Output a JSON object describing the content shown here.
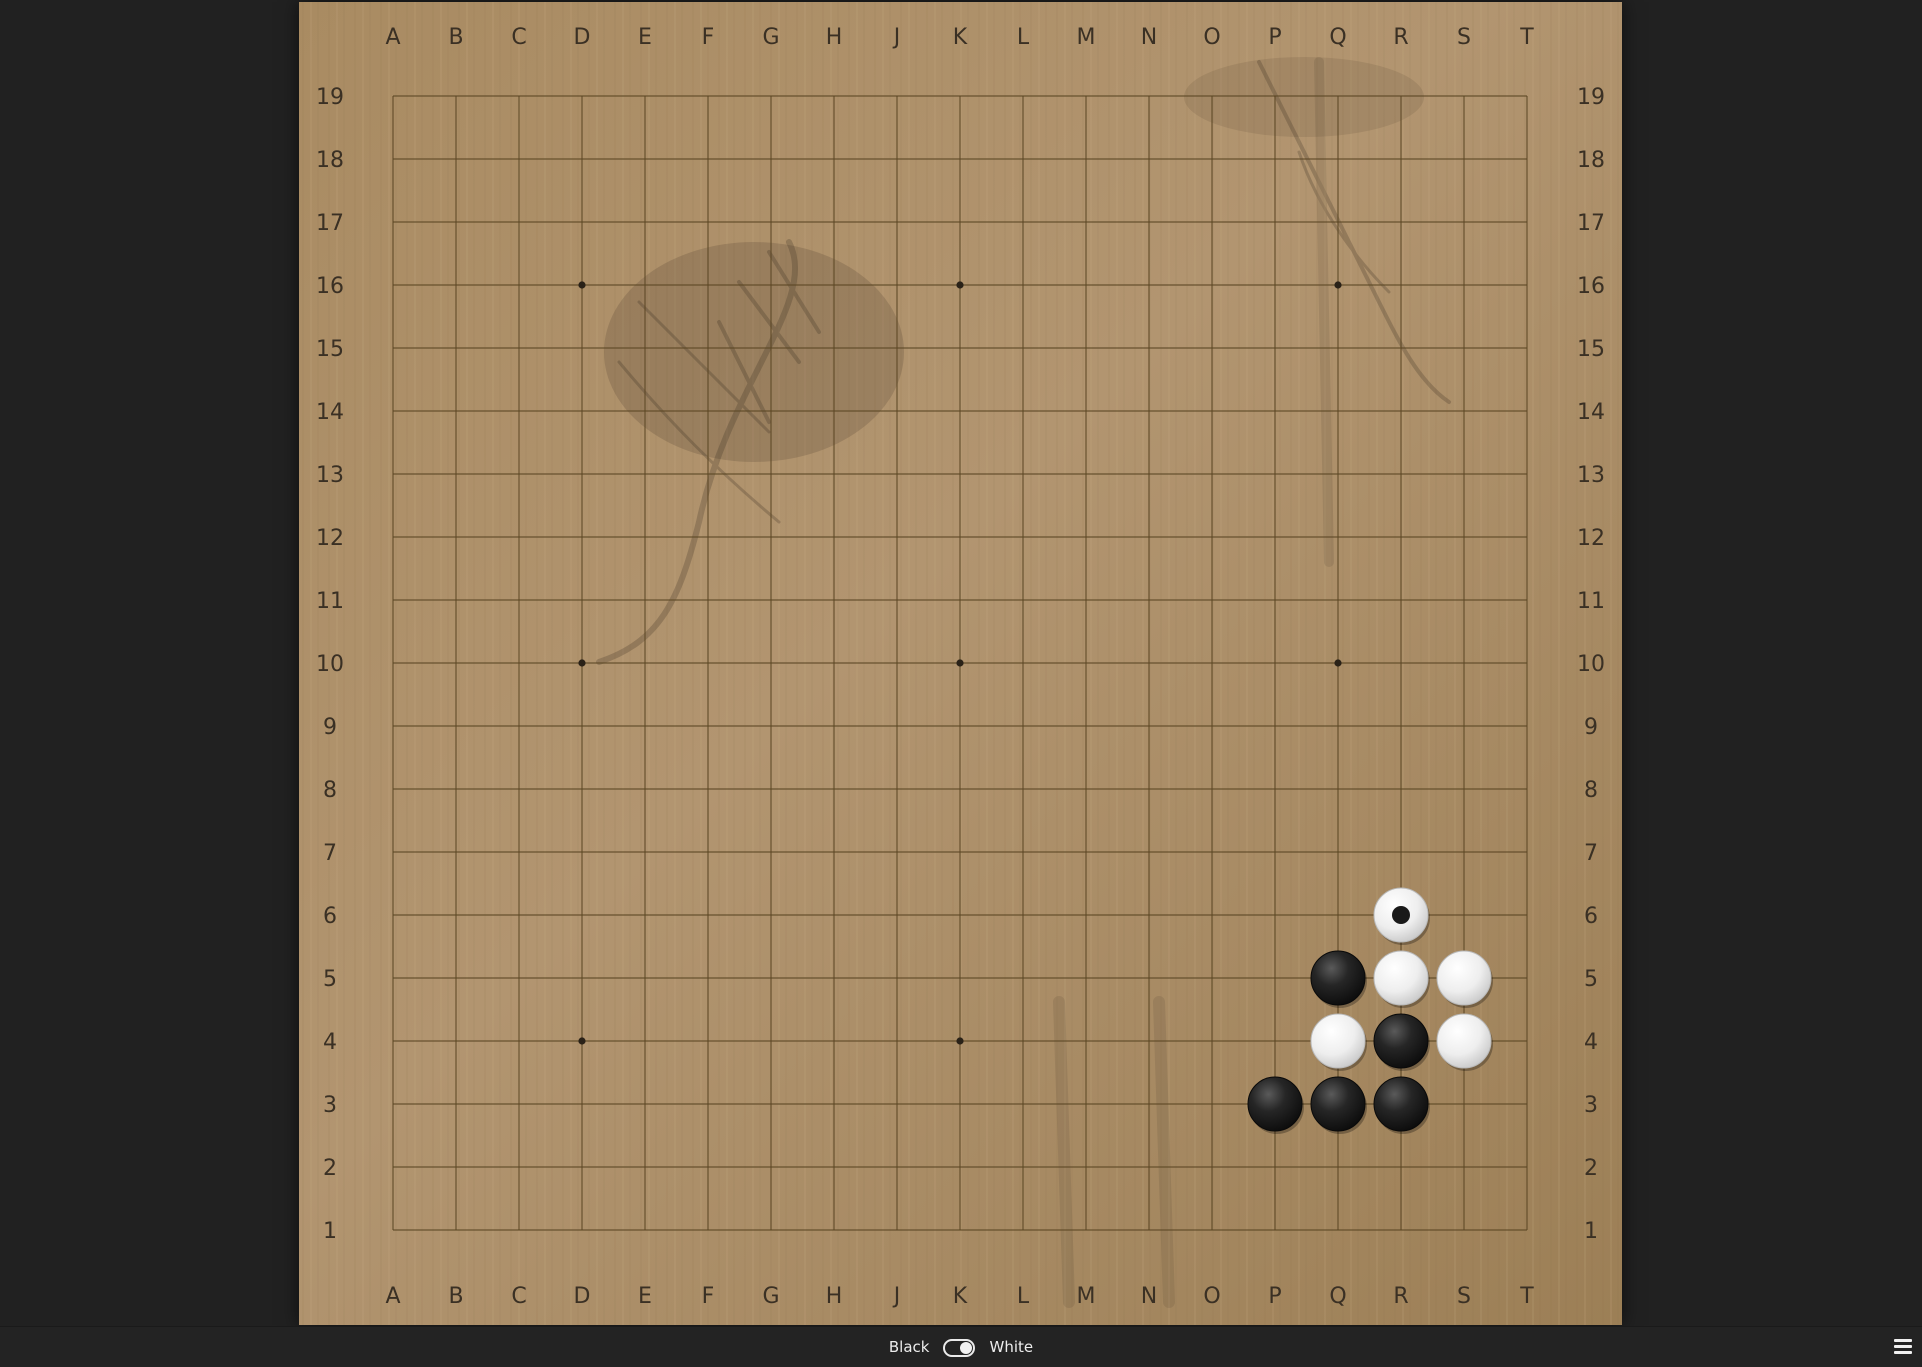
{
  "board": {
    "size": 19,
    "columns": [
      "A",
      "B",
      "C",
      "D",
      "E",
      "F",
      "G",
      "H",
      "J",
      "K",
      "L",
      "M",
      "N",
      "O",
      "P",
      "Q",
      "R",
      "S",
      "T"
    ],
    "rows": [
      "19",
      "18",
      "17",
      "16",
      "15",
      "14",
      "13",
      "12",
      "11",
      "10",
      "9",
      "8",
      "7",
      "6",
      "5",
      "4",
      "3",
      "2",
      "1"
    ],
    "hoshi": [
      "D16",
      "K16",
      "Q16",
      "D10",
      "K10",
      "Q10",
      "D4",
      "K4",
      "Q4"
    ],
    "stones": [
      {
        "point": "R6",
        "color": "white",
        "last_move": true
      },
      {
        "point": "Q5",
        "color": "black"
      },
      {
        "point": "R5",
        "color": "white"
      },
      {
        "point": "S5",
        "color": "white"
      },
      {
        "point": "Q4",
        "color": "white"
      },
      {
        "point": "R4",
        "color": "black"
      },
      {
        "point": "S4",
        "color": "white"
      },
      {
        "point": "P3",
        "color": "black"
      },
      {
        "point": "Q3",
        "color": "black"
      },
      {
        "point": "R3",
        "color": "black"
      }
    ],
    "colors": {
      "wood": "#a8895f",
      "grid_line": "#5c4624",
      "coord_text": "#3a3024",
      "black_stone": "#1f1f1f",
      "white_stone": "#efefef"
    }
  },
  "footer": {
    "black_label": "Black",
    "white_label": "White",
    "toggle_state": "white",
    "menu_icon": "hamburger-menu-icon"
  }
}
